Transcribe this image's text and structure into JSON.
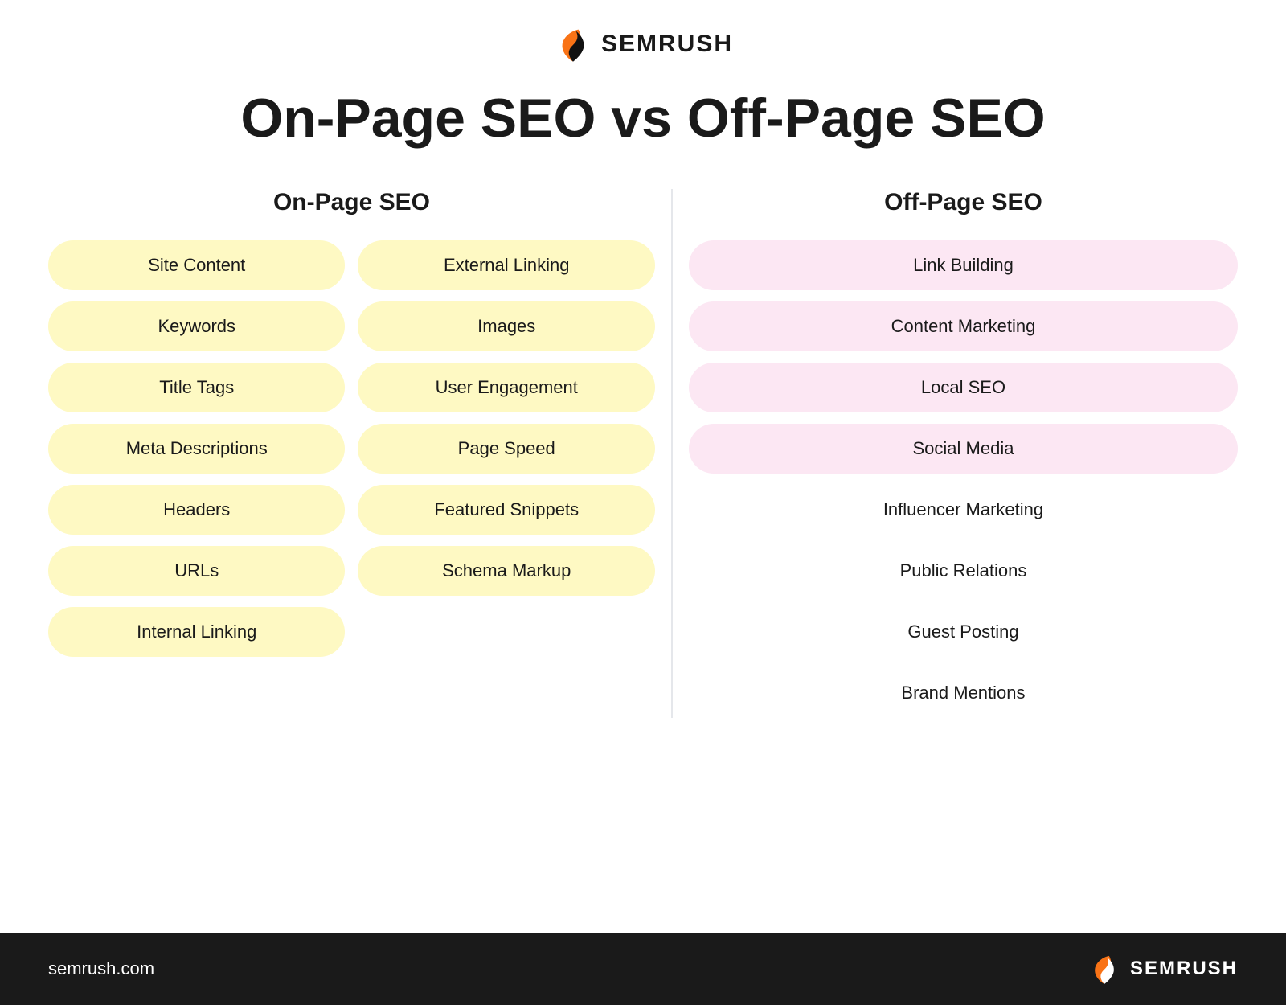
{
  "logo": {
    "text": "SEMRUSH",
    "url": "semrush.com"
  },
  "title": "On-Page SEO vs Off-Page SEO",
  "on_page": {
    "column_title": "On-Page SEO",
    "left_pills": [
      "Site Content",
      "Keywords",
      "Title Tags",
      "Meta Descriptions",
      "Headers",
      "URLs",
      "Internal Linking"
    ],
    "right_pills": [
      "External Linking",
      "Images",
      "User Engagement",
      "Page Speed",
      "Featured Snippets",
      "Schema Markup"
    ]
  },
  "off_page": {
    "column_title": "Off-Page SEO",
    "pills": [
      "Link Building",
      "Content Marketing",
      "Local SEO",
      "Social Media",
      "Influencer Marketing",
      "Public Relations",
      "Guest Posting",
      "Brand Mentions"
    ]
  },
  "footer": {
    "url": "semrush.com",
    "logo_text": "SEMRUSH"
  }
}
